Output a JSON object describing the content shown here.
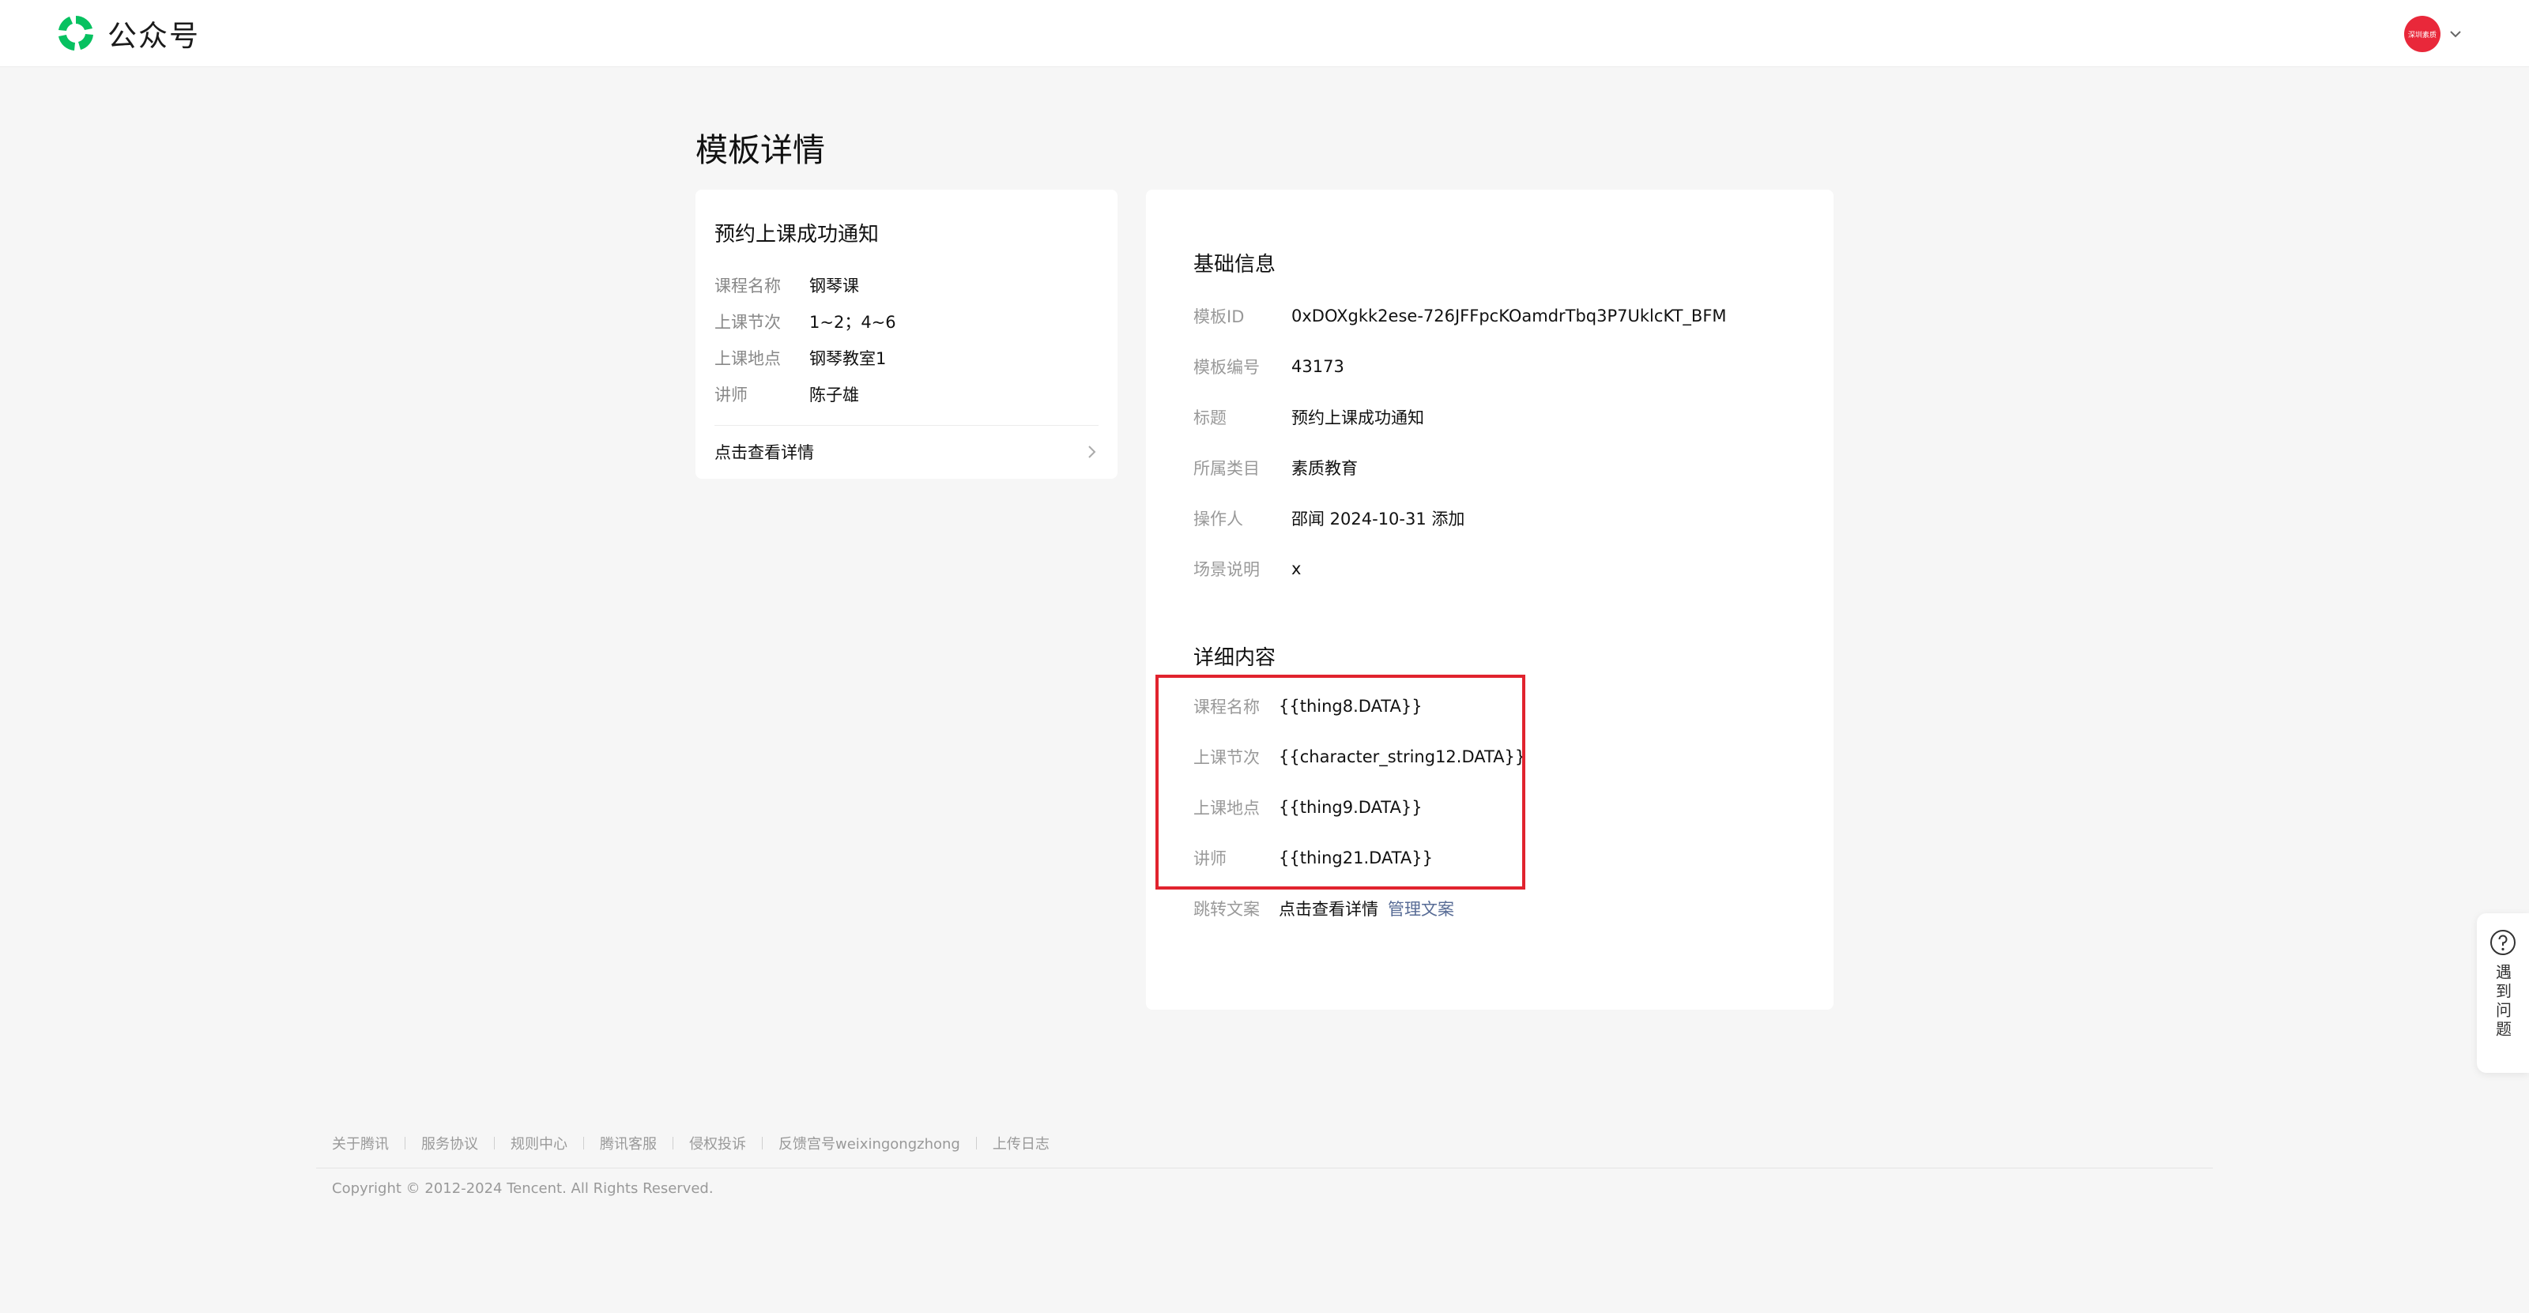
{
  "app": {
    "name": "公众号"
  },
  "account": {
    "avatar_text": "深圳素质"
  },
  "page": {
    "title": "模板详情"
  },
  "preview": {
    "title": "预约上课成功通知",
    "rows": [
      {
        "label": "课程名称",
        "value": "钢琴课"
      },
      {
        "label": "上课节次",
        "value": "1~2；4~6"
      },
      {
        "label": "上课地点",
        "value": "钢琴教室1"
      },
      {
        "label": "讲师",
        "value": "陈子雄"
      }
    ],
    "footer_label": "点击查看详情"
  },
  "basic_info": {
    "section_title": "基础信息",
    "rows": [
      {
        "label": "模板ID",
        "value": "0xDOXgkk2ese-726JFFpcKOamdrTbq3P7UklcKT_BFM"
      },
      {
        "label": "模板编号",
        "value": "43173"
      },
      {
        "label": "标题",
        "value": "预约上课成功通知"
      },
      {
        "label": "所属类目",
        "value": "素质教育"
      },
      {
        "label": "操作人",
        "value": "邵闻 2024-10-31 添加"
      },
      {
        "label": "场景说明",
        "value": "x"
      }
    ]
  },
  "detail": {
    "section_title": "详细内容",
    "rows": [
      {
        "label": "课程名称",
        "value": "{{thing8.DATA}}"
      },
      {
        "label": "上课节次",
        "value": "{{character_string12.DATA}}"
      },
      {
        "label": "上课地点",
        "value": "{{thing9.DATA}}"
      },
      {
        "label": "讲师",
        "value": "{{thing21.DATA}}"
      }
    ],
    "jump": {
      "label": "跳转文案",
      "value": "点击查看详情",
      "link": "管理文案"
    }
  },
  "help": {
    "label": "遇到问题"
  },
  "footer": {
    "links": [
      "关于腾讯",
      "服务协议",
      "规则中心",
      "腾讯客服",
      "侵权投诉",
      "反馈宫号weixingongzhong",
      "上传日志"
    ],
    "copyright": "Copyright © 2012-2024 Tencent. All Rights Reserved."
  },
  "colors": {
    "brand_green": "#07c160",
    "highlight_red": "#e1232e",
    "link": "#576b95",
    "avatar_red": "#e9283a"
  }
}
